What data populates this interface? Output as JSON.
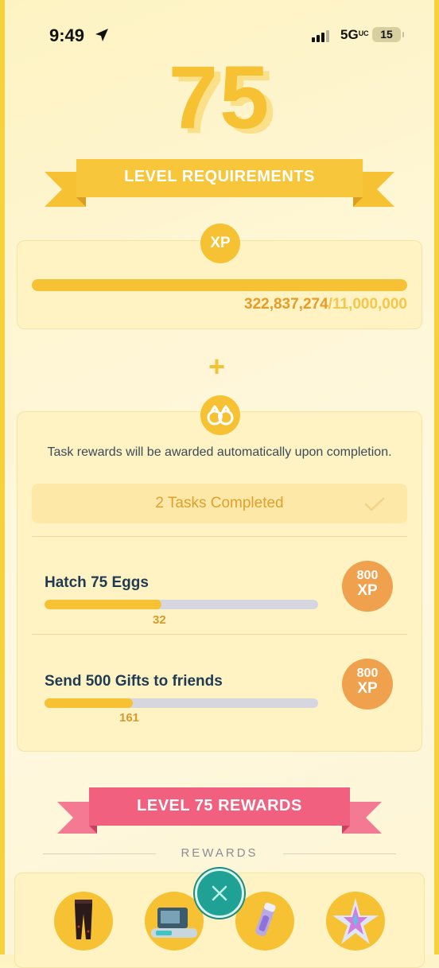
{
  "status_bar": {
    "time": "9:49",
    "network": "5G",
    "network_sub": "UC",
    "battery": "15"
  },
  "level": "75",
  "requirements_ribbon": "LEVEL REQUIREMENTS",
  "xp_section": {
    "badge": "XP",
    "current": "322,837,274",
    "required": "/11,000,000",
    "progress": 1.0
  },
  "plus": "+",
  "tasks_section": {
    "note": "Task rewards will be awarded automatically upon completion.",
    "completed_label": "2 Tasks Completed",
    "tasks": [
      {
        "title": "Hatch 75 Eggs",
        "value": "32",
        "progress": 0.427,
        "reward_amount": "800",
        "reward_unit": "XP"
      },
      {
        "title": "Send 500 Gifts to friends",
        "value": "161",
        "progress": 0.322,
        "reward_amount": "800",
        "reward_unit": "XP"
      }
    ]
  },
  "rewards_ribbon": "LEVEL 75 REWARDS",
  "rewards_subtitle": "REWARDS",
  "colors": {
    "gold": "#f6c233",
    "orange": "#f0a14d",
    "pink_ribbon": "#f2607f",
    "teal_button": "#1fa295"
  },
  "icons": [
    "location-arrow-icon",
    "signal-icon",
    "binoculars-icon",
    "checkmark-icon",
    "pants-icon",
    "incubator-icon",
    "item-vial-icon",
    "star-piece-icon",
    "close-icon"
  ]
}
